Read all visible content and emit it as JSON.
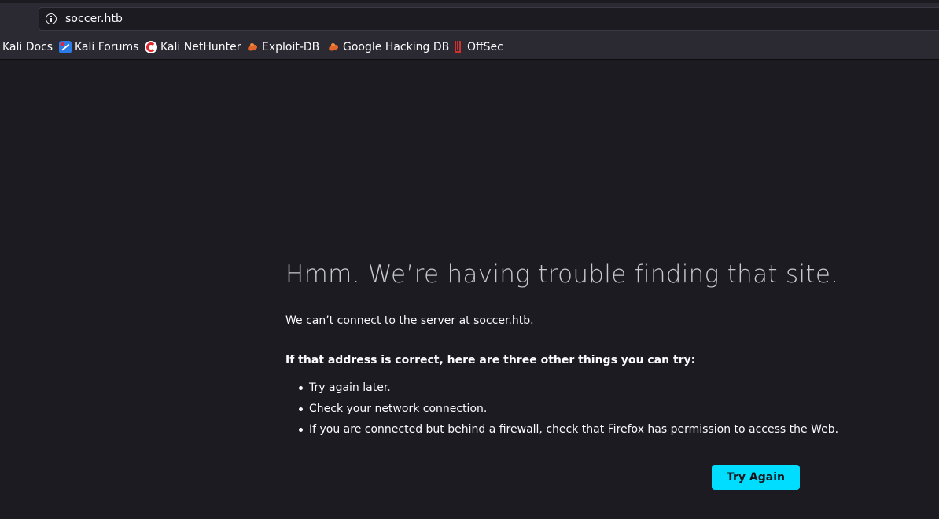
{
  "browser": {
    "url": "soccer.htb",
    "bookmarks": [
      {
        "label": "Kali Docs",
        "icon": "kali-docs-icon"
      },
      {
        "label": "Kali Forums",
        "icon": "kali-forums-icon"
      },
      {
        "label": "Kali NetHunter",
        "icon": "kali-nethunter-icon"
      },
      {
        "label": "Exploit-DB",
        "icon": "exploit-db-icon"
      },
      {
        "label": "Google Hacking DB",
        "icon": "google-hacking-db-icon"
      },
      {
        "label": "OffSec",
        "icon": "offsec-icon"
      }
    ]
  },
  "error_page": {
    "title": "Hmm. We’re having trouble finding that site.",
    "description": "We can’t connect to the server at soccer.htb.",
    "suggestions_heading": "If that address is correct, here are three other things you can try:",
    "suggestions": [
      "Try again later.",
      "Check your network connection.",
      "If you are connected but behind a firewall, check that Firefox has permission to access the Web."
    ],
    "try_again_label": "Try Again"
  },
  "colors": {
    "background": "#1c1b22",
    "toolbar": "#2b2a33",
    "accent_button": "#00ddff"
  }
}
